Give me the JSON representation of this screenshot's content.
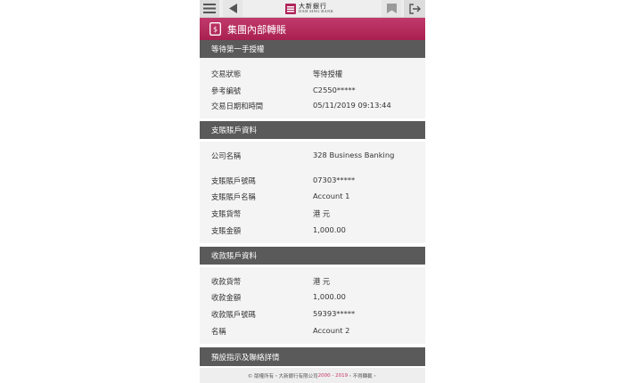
{
  "topbar": {
    "logo_cn": "大新銀行",
    "logo_en": "DAH SING BANK",
    "icons": [
      "menu-icon",
      "back-icon",
      "bookmark-icon",
      "logout-icon"
    ]
  },
  "page": {
    "title": "集團內部轉賬"
  },
  "status_section": {
    "header": "等待第一手授權",
    "rows": [
      {
        "label": "交易狀態",
        "value": "等待授權"
      },
      {
        "label": "參考編號",
        "value": "C2550*****"
      },
      {
        "label": "交易日期和時間",
        "value": "05/11/2019 09:13:44"
      }
    ]
  },
  "debit_section": {
    "header": "支賬賬戶資料",
    "rows": [
      {
        "label": "公司名稱",
        "value": "328 Business Banking"
      },
      {
        "label": "支賬賬戶號碼",
        "value": "07303*****"
      },
      {
        "label": "支賬賬戶名稱",
        "value": "Account 1"
      },
      {
        "label": "支賬貨幣",
        "value": "港 元"
      },
      {
        "label": "支賬金額",
        "value": "1,000.00"
      }
    ]
  },
  "credit_section": {
    "header": "收款賬戶資料",
    "rows": [
      {
        "label": "收款貨幣",
        "value": "港 元"
      },
      {
        "label": "收款金額",
        "value": "1,000.00"
      },
      {
        "label": "收款賬戶號碼",
        "value": "59393*****"
      },
      {
        "label": "名稱",
        "value": "Account 2"
      }
    ]
  },
  "details_section": {
    "header": "預設指示及聯絡詳情"
  },
  "footer": {
    "prefix": "© 版權所有・大新銀行有限公司",
    "years": "2000 - 2019",
    "suffix": "・不得轉載・"
  },
  "colors": {
    "brand": "#b0265a",
    "section_header": "#5a5a5a",
    "body_bg": "#f4f4f4"
  }
}
